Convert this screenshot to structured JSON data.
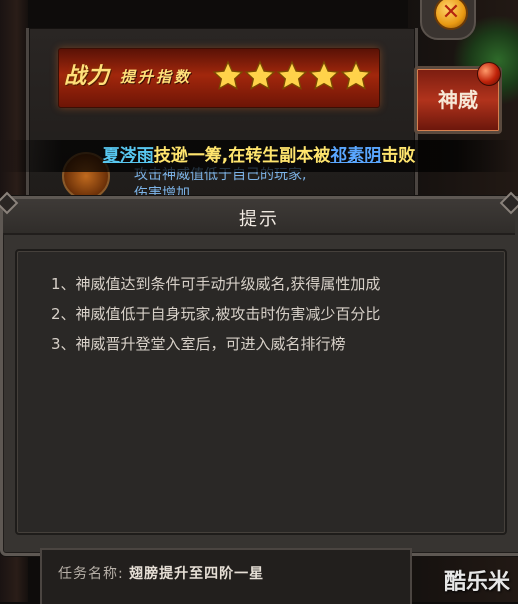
{
  "top_panel": {
    "rank_title_big": "战力",
    "rank_title_small": "提升指数",
    "stars": 5,
    "hidden_description_line1": "攻击神威值低于自己的玩家,",
    "hidden_description_line2": "伤害增加..."
  },
  "side_button": {
    "label": "神威"
  },
  "close_button": {
    "label": "✕"
  },
  "ticker": {
    "player1": "夏涔雨",
    "text1": "技逊一筹,在转生副本被",
    "player2": "祁素阴",
    "text2": "击败"
  },
  "dialog": {
    "title": "提示",
    "lines": [
      "1、神威值达到条件可手动升级威名,获得属性加成",
      "2、神威值低于自身玩家,被攻击时伤害减少百分比",
      "3、神威晋升登堂入室后，可进入威名排行榜"
    ]
  },
  "bottom_panel": {
    "task_label": "任务名称:",
    "task_value": "翅膀提升至四阶一星"
  },
  "watermark": "酷乐米",
  "colors": {
    "star_gold": "#ffd24a",
    "ticker_text": "#ffe56e",
    "player_link": "#58c7f0",
    "dialog_bg": "#373431",
    "button_red": "#b1331c"
  }
}
